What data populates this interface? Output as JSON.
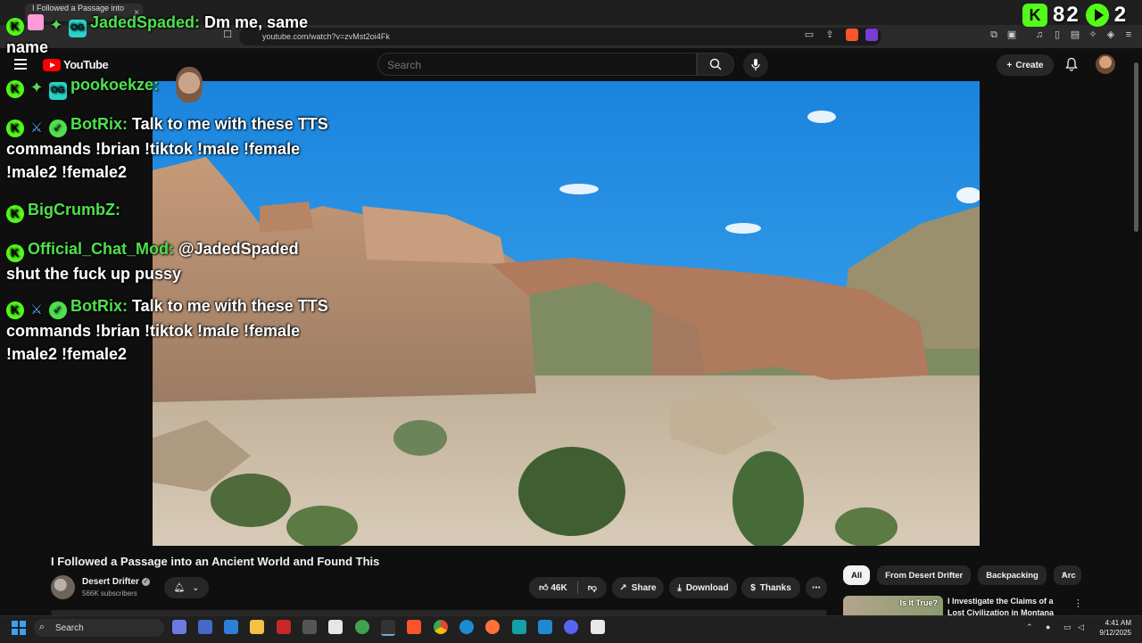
{
  "browser": {
    "tab_title": "I Followed a Passage into an",
    "url": "youtube.com/watch?v=zvMst2oi4Fk"
  },
  "youtube": {
    "logo_text": "YouTube",
    "search_placeholder": "Search",
    "create_label": "Create"
  },
  "video": {
    "title": "I Followed a Passage into an Ancient World and Found This",
    "channel": "Desert Drifter",
    "subscribers": "566K subscribers",
    "likes": "46K",
    "share_label": "Share",
    "download_label": "Download",
    "thanks_label": "Thanks"
  },
  "chips": [
    "All",
    "From Desert Drifter",
    "Backpacking",
    "Arc"
  ],
  "recommendation": {
    "thumb_text": "Is It True?",
    "title": "I Investigate the Claims of a Lost Civilization in Montana"
  },
  "taskbar": {
    "search_label": "Search",
    "time": "4:41 AM",
    "date": "9/12/2025"
  },
  "overlay": {
    "viewer_count": "82",
    "viewer_count_2": "2",
    "chat": [
      {
        "user": "JadedSpaded:",
        "text": "Dm me, same"
      },
      {
        "user": "",
        "text": "name"
      },
      {
        "user": "pookoekze:",
        "text": ""
      },
      {
        "user": "BotRix:",
        "text": "Talk to me with these TTS"
      },
      {
        "user": "",
        "text": "commands !brian !tiktok !male !female"
      },
      {
        "user": "",
        "text": "!male2 !female2"
      },
      {
        "user": "BigCrumbZ:",
        "text": ""
      },
      {
        "user": "Official_Chat_Mod:",
        "text": "@JadedSpaded"
      },
      {
        "user": "",
        "text": "shut the fuck up pussy"
      },
      {
        "user": "BotRix:",
        "text": "Talk to me with these TTS"
      },
      {
        "user": "",
        "text": "commands !brian !tiktok !male !female"
      },
      {
        "user": "",
        "text": "!male2 !female2"
      }
    ]
  },
  "colors": {
    "chat_user": "#4ee04e",
    "kick_green": "#53fc18",
    "yt_red": "#ff0000"
  }
}
